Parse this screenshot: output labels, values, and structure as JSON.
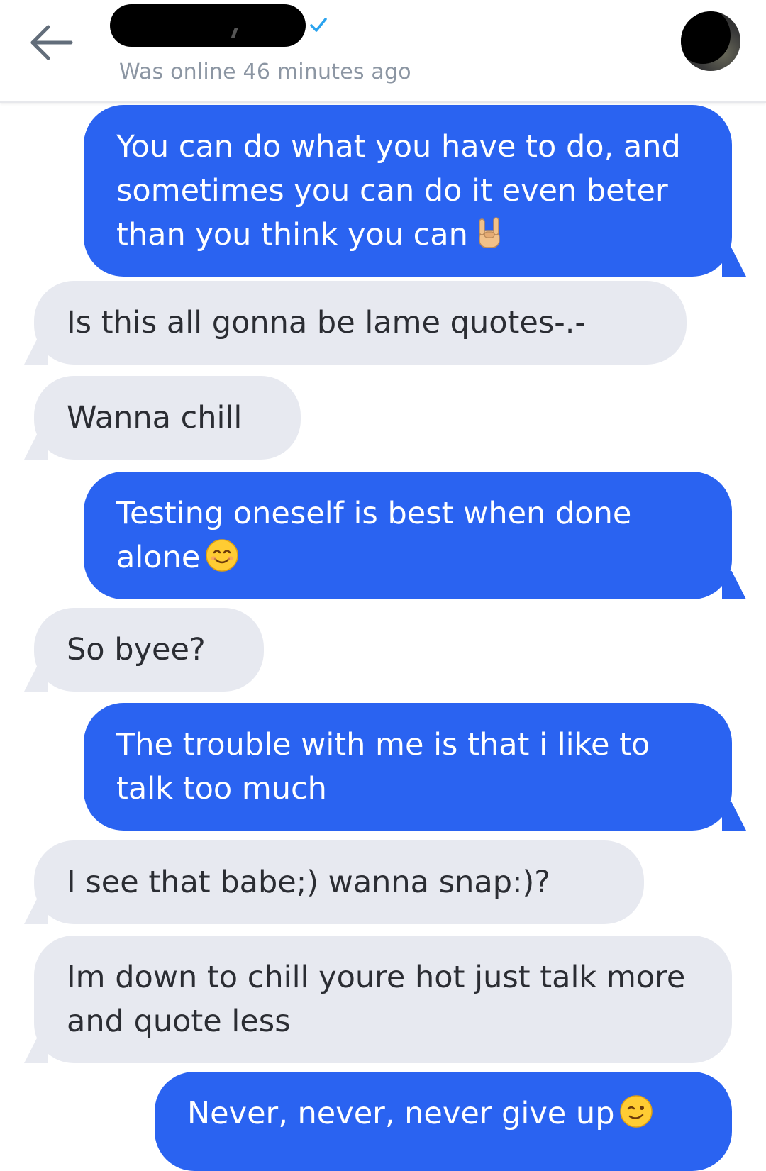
{
  "header": {
    "status": "Was online 46 minutes ago",
    "colors": {
      "verified": "#2aa3ef",
      "back_arrow": "#626d7a"
    }
  },
  "messages": [
    {
      "direction": "out",
      "text": "You can do what you have to do, and sometimes you can do it even beter than you think you can",
      "emoji": "sign-of-the-horns-emoji"
    },
    {
      "direction": "in",
      "text": "Is this all gonna be lame quotes-.-"
    },
    {
      "direction": "in",
      "text": "Wanna chill"
    },
    {
      "direction": "out",
      "text": "Testing oneself is best when done alone",
      "emoji": "smiling-face-emoji"
    },
    {
      "direction": "in",
      "text": "So byee?"
    },
    {
      "direction": "out",
      "text": "The trouble with me is that i like to talk too much"
    },
    {
      "direction": "in",
      "text": "I see that babe;) wanna snap:)?"
    },
    {
      "direction": "in",
      "text": "Im down to chill youre hot just talk more and quote less"
    },
    {
      "direction": "out",
      "text": "Never, never, never give up",
      "emoji": "winking-face-emoji"
    }
  ],
  "colors": {
    "outgoing_bubble": "#2a63f1",
    "incoming_bubble": "#e7e9f0",
    "incoming_text": "#2b2d33",
    "status_text": "#8c96a3"
  }
}
